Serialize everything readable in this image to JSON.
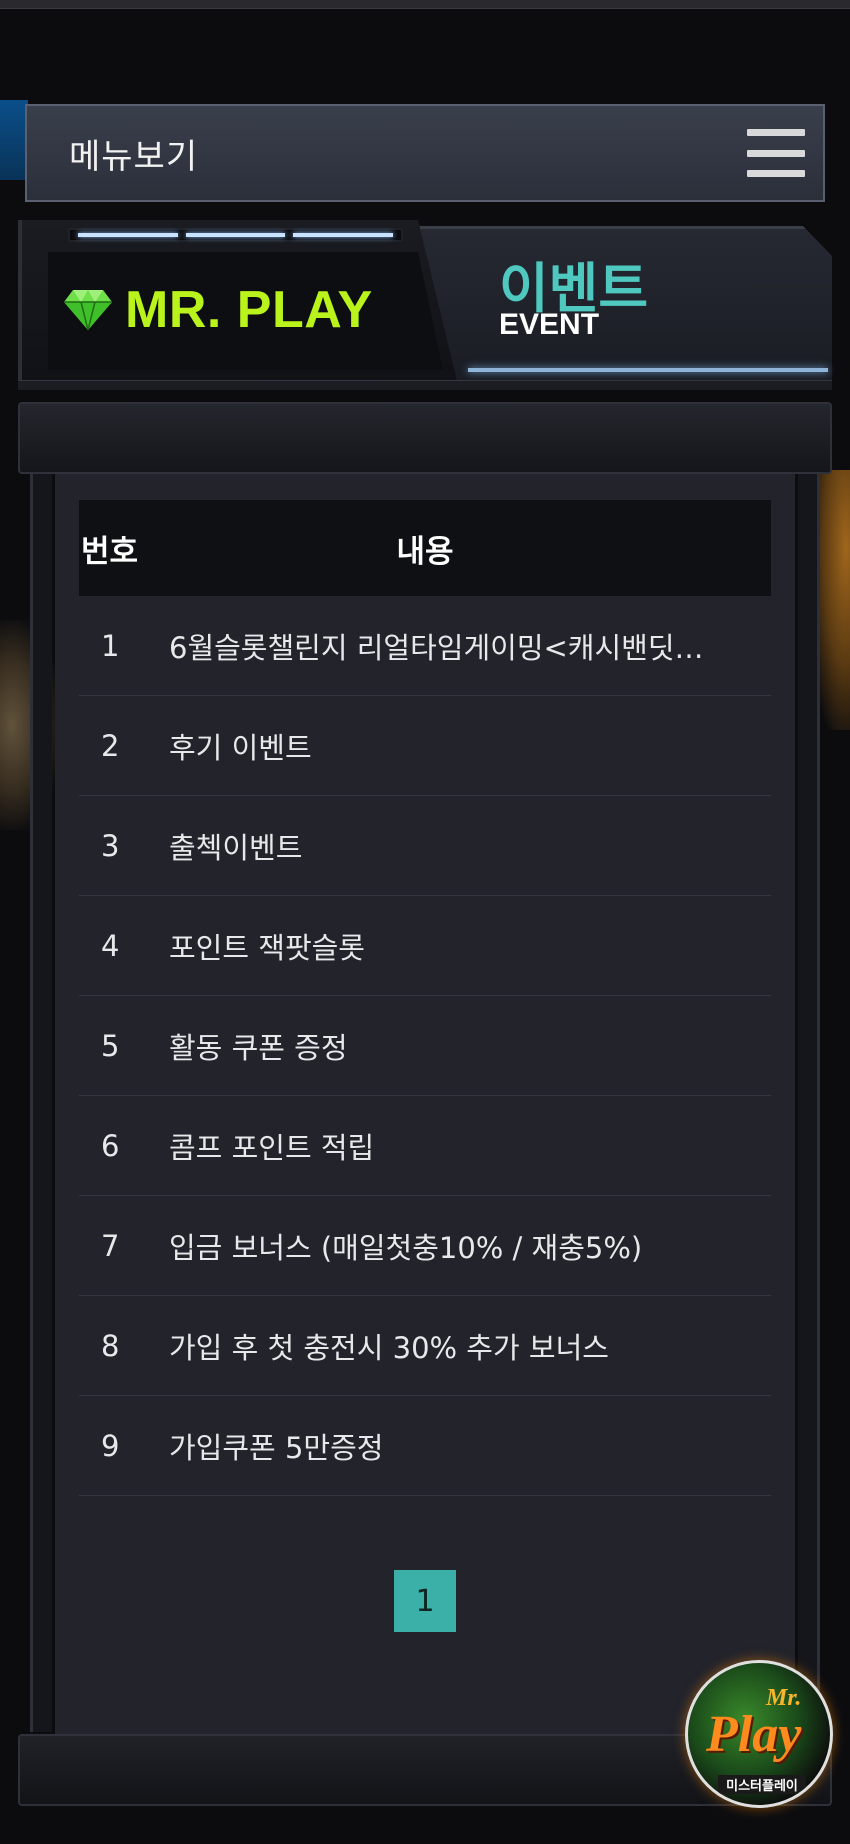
{
  "header": {
    "menu_title": "메뉴보기"
  },
  "banner": {
    "brand_name": "MR. PLAY",
    "event_ko": "이벤트",
    "event_en": "EVENT"
  },
  "table": {
    "columns": [
      "번호",
      "내용"
    ],
    "rows": [
      {
        "num": "1",
        "title": "6월슬롯챌린지 리얼타임게이밍<캐시밴딧…"
      },
      {
        "num": "2",
        "title": "후기 이벤트"
      },
      {
        "num": "3",
        "title": "출첵이벤트"
      },
      {
        "num": "4",
        "title": "포인트 잭팟슬롯"
      },
      {
        "num": "5",
        "title": "활동 쿠폰 증정"
      },
      {
        "num": "6",
        "title": "콤프 포인트 적립"
      },
      {
        "num": "7",
        "title": "입금 보너스 (매일첫충10% / 재충5%)"
      },
      {
        "num": "8",
        "title": "가입 후 첫 충전시 30% 추가 보너스"
      },
      {
        "num": "9",
        "title": "가입쿠폰 5만증정"
      }
    ]
  },
  "pagination": {
    "current": "1"
  },
  "float_logo": {
    "mr": "Mr.",
    "play": "Play",
    "sub": "미스터플레이"
  },
  "colors": {
    "brand_green": "#b9f31b",
    "event_teal": "#4fc8c0",
    "page_active": "#3bb0a8"
  },
  "icons": {
    "menu": "hamburger-icon",
    "brand": "diamond-icon"
  }
}
